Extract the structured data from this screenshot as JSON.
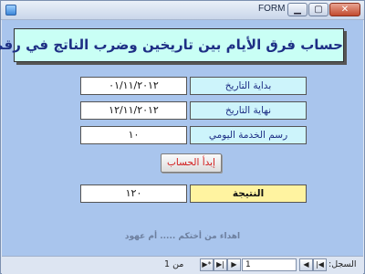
{
  "window": {
    "title": "FORM",
    "minimize": "▁",
    "maximize": "▢",
    "close": "✕"
  },
  "form": {
    "heading": "حساب فرق الأيام بين تاريخين وضرب الناتج في رقم",
    "start_date": {
      "label": "بداية التاريخ",
      "value": "٠١/١١/٢٠١٢"
    },
    "end_date": {
      "label": "نهاية التاريخ",
      "value": "١٢/١١/٢٠١٢"
    },
    "daily_fee": {
      "label": "رسم الخدمة اليومي",
      "value": "١٠"
    },
    "calc_button": "إبدأ الحساب",
    "result": {
      "label": "النتيجة",
      "value": "١٢٠"
    },
    "credit": "اهداء من أختكم ..... أم عهود"
  },
  "navigation": {
    "record_label": "السجل:",
    "record_value": "1",
    "of_text": "من 1",
    "first": "|◀",
    "prev": "◀",
    "next": "▶",
    "last": "▶|",
    "new": "▶*"
  }
}
